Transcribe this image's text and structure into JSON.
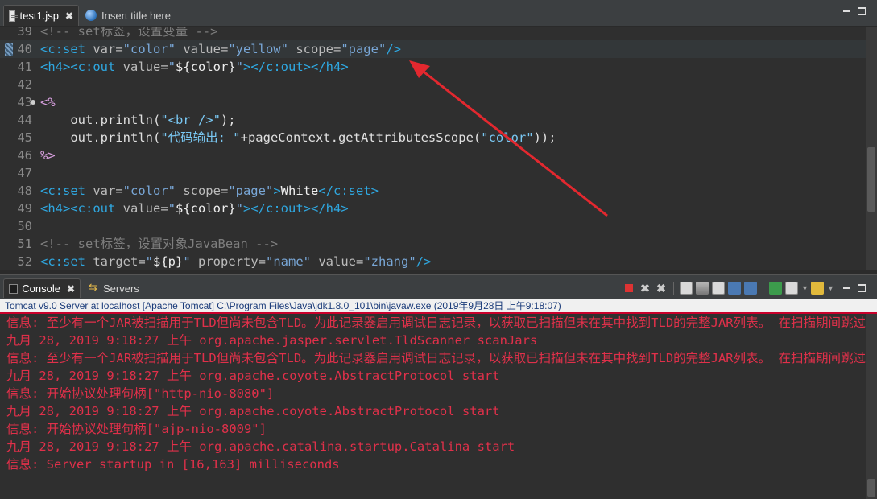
{
  "editor": {
    "tabs": [
      {
        "label": "test1.jsp",
        "close": "✖"
      },
      {
        "label": "Insert title here"
      }
    ],
    "lines": [
      {
        "num": "39",
        "segments": [
          {
            "c": "c-comment",
            "t": "<!-- set标签，设置变量 -->"
          }
        ]
      },
      {
        "num": "40",
        "segments": [
          {
            "c": "c-tag",
            "t": "<c:set "
          },
          {
            "c": "c-attr",
            "t": "var="
          },
          {
            "c": "c-val",
            "t": "\"color\" "
          },
          {
            "c": "c-attr",
            "t": "value="
          },
          {
            "c": "c-val",
            "t": "\"yellow\" "
          },
          {
            "c": "c-attr",
            "t": "scope="
          },
          {
            "c": "c-val",
            "t": "\"page\""
          },
          {
            "c": "c-tag",
            "t": "/>"
          }
        ]
      },
      {
        "num": "41",
        "segments": [
          {
            "c": "c-tag",
            "t": "<h4><c:out "
          },
          {
            "c": "c-attr",
            "t": "value="
          },
          {
            "c": "c-val",
            "t": "\""
          },
          {
            "c": "c-text",
            "t": "${color}"
          },
          {
            "c": "c-val",
            "t": "\""
          },
          {
            "c": "c-tag",
            "t": "></c:out></h4>"
          }
        ]
      },
      {
        "num": "42",
        "segments": []
      },
      {
        "num": "43",
        "segments": [
          {
            "c": "c-jsp",
            "t": "<%"
          }
        ]
      },
      {
        "num": "44",
        "segments": [
          {
            "c": "c-plain",
            "t": "    out.println("
          },
          {
            "c": "c-str",
            "t": "\"<br />\""
          },
          {
            "c": "c-plain",
            "t": ");"
          }
        ]
      },
      {
        "num": "45",
        "segments": [
          {
            "c": "c-plain",
            "t": "    out.println("
          },
          {
            "c": "c-str",
            "t": "\"代码输出: \""
          },
          {
            "c": "c-plain",
            "t": "+pageContext.getAttributesScope("
          },
          {
            "c": "c-str",
            "t": "\"color\""
          },
          {
            "c": "c-plain",
            "t": "));"
          }
        ]
      },
      {
        "num": "46",
        "segments": [
          {
            "c": "c-jsp",
            "t": "%>"
          }
        ]
      },
      {
        "num": "47",
        "segments": []
      },
      {
        "num": "48",
        "segments": [
          {
            "c": "c-tag",
            "t": "<c:set "
          },
          {
            "c": "c-attr",
            "t": "var="
          },
          {
            "c": "c-val",
            "t": "\"color\" "
          },
          {
            "c": "c-attr",
            "t": "scope="
          },
          {
            "c": "c-val",
            "t": "\"page\""
          },
          {
            "c": "c-tag",
            "t": ">"
          },
          {
            "c": "c-text",
            "t": "White"
          },
          {
            "c": "c-tag",
            "t": "</c:set>"
          }
        ]
      },
      {
        "num": "49",
        "segments": [
          {
            "c": "c-tag",
            "t": "<h4><c:out "
          },
          {
            "c": "c-attr",
            "t": "value="
          },
          {
            "c": "c-val",
            "t": "\""
          },
          {
            "c": "c-text",
            "t": "${color}"
          },
          {
            "c": "c-val",
            "t": "\""
          },
          {
            "c": "c-tag",
            "t": "></c:out></h4>"
          }
        ]
      },
      {
        "num": "50",
        "segments": []
      },
      {
        "num": "51",
        "segments": [
          {
            "c": "c-comment",
            "t": "<!-- set标签，设置对象JavaBean -->"
          }
        ]
      },
      {
        "num": "52",
        "segments": [
          {
            "c": "c-tag",
            "t": "<c:set "
          },
          {
            "c": "c-attr",
            "t": "target="
          },
          {
            "c": "c-val",
            "t": "\""
          },
          {
            "c": "c-text",
            "t": "${p}"
          },
          {
            "c": "c-val",
            "t": "\" "
          },
          {
            "c": "c-attr",
            "t": "property="
          },
          {
            "c": "c-val",
            "t": "\"name\" "
          },
          {
            "c": "c-attr",
            "t": "value="
          },
          {
            "c": "c-val",
            "t": "\"zhang\""
          },
          {
            "c": "c-tag",
            "t": "/>"
          }
        ]
      }
    ],
    "current_line": "40",
    "fold_line": "43"
  },
  "console": {
    "tabs": [
      {
        "label": "Console",
        "close": "✖"
      },
      {
        "label": "Servers"
      }
    ],
    "header": "Tomcat v9.0 Server at localhost [Apache Tomcat] C:\\Program Files\\Java\\jdk1.8.0_101\\bin\\javaw.exe (2019年9月28日 上午9:18:07)",
    "lines": [
      "信息: 至少有一个JAR被扫描用于TLD但尚未包含TLD。为此记录器启用调试日志记录，以获取已扫描但未在其中找到TLD的完整JAR列表。 在扫描期间跳过不需",
      "九月 28, 2019 9:18:27 上午 org.apache.jasper.servlet.TldScanner scanJars",
      "信息: 至少有一个JAR被扫描用于TLD但尚未包含TLD。为此记录器启用调试日志记录，以获取已扫描但未在其中找到TLD的完整JAR列表。 在扫描期间跳过不需",
      "九月 28, 2019 9:18:27 上午 org.apache.coyote.AbstractProtocol start",
      "信息: 开始协议处理句柄[\"http-nio-8080\"]",
      "九月 28, 2019 9:18:27 上午 org.apache.coyote.AbstractProtocol start",
      "信息: 开始协议处理句柄[\"ajp-nio-8009\"]",
      "九月 28, 2019 9:18:27 上午 org.apache.catalina.startup.Catalina start",
      "信息: Server startup in [16,163] milliseconds"
    ]
  },
  "annotation": {
    "arrow_color": "#e3282f"
  }
}
